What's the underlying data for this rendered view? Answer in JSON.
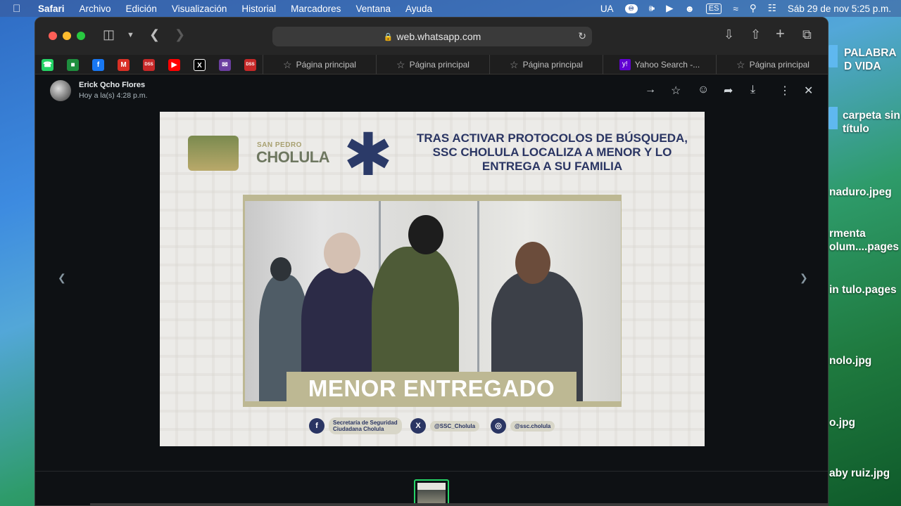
{
  "menubar": {
    "app": "Safari",
    "items": [
      "Archivo",
      "Edición",
      "Visualización",
      "Historial",
      "Marcadores",
      "Ventana",
      "Ayuda"
    ],
    "status": {
      "keyboard": "UA",
      "input_source": "ES",
      "datetime": "Sáb 29 de nov  5:25 p.m."
    }
  },
  "desktop": {
    "items": [
      "PALABRA D VIDA",
      "carpeta sin título",
      "naduro.jpeg",
      "rmenta olum....pages",
      "in tulo.pages",
      "nolo.jpg",
      "o.jpg",
      "aby ruiz.jpg"
    ]
  },
  "browser": {
    "url": "web.whatsapp.com",
    "favorites": [
      {
        "icon": "whatsapp-icon",
        "color": "#25d366"
      },
      {
        "icon": "meet-icon",
        "color": "#1e8e3e"
      },
      {
        "icon": "facebook-icon",
        "color": "#1877f2"
      },
      {
        "icon": "gmail-icon",
        "color": "#d93025"
      },
      {
        "icon": "dss-icon",
        "color": "#c62828"
      },
      {
        "icon": "youtube-icon",
        "color": "#ff0000"
      },
      {
        "icon": "x-icon",
        "color": "#000000"
      },
      {
        "icon": "mail-icon",
        "color": "#6b3fa0"
      },
      {
        "icon": "dss-icon",
        "color": "#c62828"
      }
    ],
    "tabs": [
      "Página principal",
      "Página principal",
      "Página principal",
      "Yahoo Search -...",
      "Página principal"
    ]
  },
  "chat": {
    "sender": "Erick Qcho Flores",
    "time": "Hoy a la(s) 4:28 p.m."
  },
  "poster": {
    "logo_sub": "SAN PEDRO",
    "logo_name": "CHOLULA",
    "headline": "TRAS ACTIVAR PROTOCOLOS DE BÚSQUEDA, SSC CHOLULA LOCALIZA A MENOR Y LO ENTREGA A SU FAMILIA",
    "caption": "MENOR ENTREGADO",
    "socials": [
      {
        "icon": "facebook-icon",
        "label": "Secretaría de Seguridad Ciudadana Cholula"
      },
      {
        "icon": "x-icon",
        "label": "@SSC_Cholula"
      },
      {
        "icon": "instagram-icon",
        "label": "@ssc.cholula"
      }
    ]
  },
  "colors": {
    "accent": "#25d366",
    "navy": "#2a3563",
    "gold": "#bdb893"
  }
}
